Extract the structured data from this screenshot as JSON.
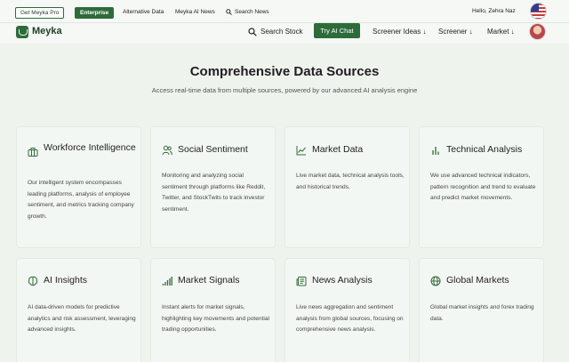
{
  "topbar": {
    "get_pro": "Get Meyka Pro",
    "enterprise": "Enterprise",
    "alternative_data": "Alternative Data",
    "ai_news": "Meyka AI News",
    "search_news": "Search News",
    "greeting": "Hello, Zehra Naz"
  },
  "nav": {
    "logo": "Meyka",
    "search_stock": "Search Stock",
    "try_ai_chat": "Try AI Chat",
    "screener_ideas": "Screener Ideas ↓",
    "screener": "Screener ↓",
    "market": "Market ↓"
  },
  "main": {
    "title": "Comprehensive Data Sources",
    "subtitle": "Access real-time data from multiple sources, powered by our advanced AI analysis engine"
  },
  "cards": [
    {
      "title": "Workforce Intelligence",
      "icon": "briefcase-icon",
      "text": "Our intelligent system encompasses leading platforms, analysis of employee sentiment, and metrics tracking company growth."
    },
    {
      "title": "Social Sentiment",
      "icon": "users-icon",
      "text": "Monitoring and analyzing social sentiment through platforms like Reddit, Twitter, and StockTwits to track investor sentiment."
    },
    {
      "title": "Market Data",
      "icon": "line-chart-icon",
      "text": "Live market data, technical analysis tools, and historical trends."
    },
    {
      "title": "Technical Analysis",
      "icon": "bar-chart-icon",
      "text": "We use advanced technical indicators, pattern recognition and trend to evaluate and predict market movements."
    },
    {
      "title": "AI Insights",
      "icon": "brain-icon",
      "text": "AI data-driven models for predictive analytics and risk assessment, leveraging advanced insights."
    },
    {
      "title": "Market Signals",
      "icon": "signal-icon",
      "text": "Instant alerts for market signals, highlighting key movements and potential trading opportunities."
    },
    {
      "title": "News Analysis",
      "icon": "newspaper-icon",
      "text": "Live news aggregation and sentiment analysis from global sources, focusing on comprehensive news analysis."
    },
    {
      "title": "Global Markets",
      "icon": "globe-icon",
      "text": "Global market insights and forex trading data."
    }
  ],
  "colors": {
    "accent": "#2e6b3a",
    "background": "#eef3ee",
    "card": "#f3f7f3"
  }
}
